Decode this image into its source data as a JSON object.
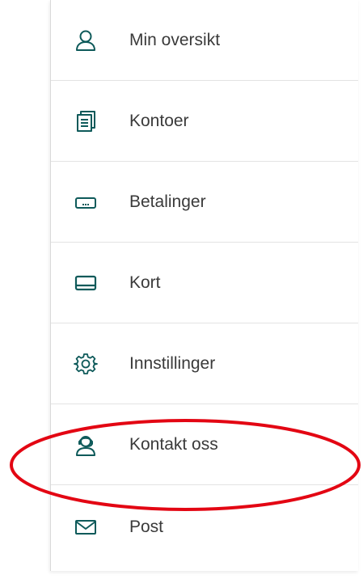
{
  "menu": {
    "items": [
      {
        "label": "Min oversikt",
        "icon": "user-icon"
      },
      {
        "label": "Kontoer",
        "icon": "document-stack-icon"
      },
      {
        "label": "Betalinger",
        "icon": "payment-icon"
      },
      {
        "label": "Kort",
        "icon": "card-icon"
      },
      {
        "label": "Innstillinger",
        "icon": "gear-icon"
      },
      {
        "label": "Kontakt oss",
        "icon": "support-agent-icon"
      },
      {
        "label": "Post",
        "icon": "mail-icon"
      }
    ]
  },
  "colors": {
    "icon": "#0e5a5a",
    "text": "#3a3a3a",
    "divider": "#e3e3e3",
    "highlight": "#e30613"
  },
  "annotation": {
    "highlighted_item": "Kontakt oss"
  }
}
